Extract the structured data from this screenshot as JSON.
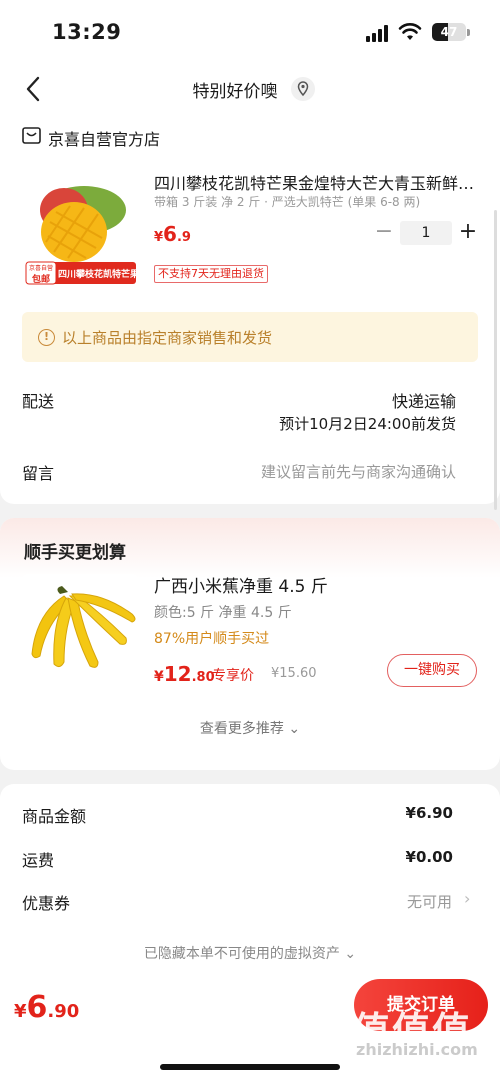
{
  "status": {
    "time": "13:29",
    "battery": "47",
    "battery_level": 0.47
  },
  "nav": {
    "title": "特别好价噢"
  },
  "order": {
    "store_name": "京喜自营官方店",
    "product": {
      "title": "四川攀枝花凯特芒果金煌特大芒大青玉新鲜水果",
      "spec": "带箱 3 斤装 净 2 斤 · 严选大凯特芒 (单果 6-8 两)",
      "price_symbol": "¥",
      "price_int": "6",
      "price_dec": ".9",
      "quantity": "1",
      "minus": "−",
      "plus": "+",
      "return_policy": "不支持7天无理由退货",
      "image_badge_top": "京喜自营",
      "image_badge_free": "包邮",
      "image_badge_label": "四川攀枝花凯特芒果"
    },
    "notice": "以上商品由指定商家销售和发货",
    "notice_icon": "!",
    "delivery_label": "配送",
    "delivery_method": "快递运输",
    "delivery_estimate": "预计10月2日24:00前发货",
    "note_label": "留言",
    "note_placeholder": "建议留言前先与商家沟通确认"
  },
  "upsell": {
    "title": "顺手买更划算",
    "name": "广西小米蕉净重 4.5 斤",
    "spec": "颜色:5 斤 净重 4.5 斤",
    "bought": "87%用户顺手买过",
    "price_symbol": "¥",
    "price_int": "12",
    "price_dec": ".80",
    "price_tag": "专享价",
    "original_price": "¥15.60",
    "buy_label": "一键购买",
    "more_label": "查看更多推荐 ⌄"
  },
  "summary": {
    "goods_label": "商品金额",
    "goods_value": "¥6.90",
    "shipping_label": "运费",
    "shipping_value": "¥0.00",
    "coupon_label": "优惠券",
    "coupon_value": "无可用",
    "coupon_arrow": "›",
    "hidden_assets": "已隐藏本单不可使用的虚拟资产 ⌄"
  },
  "bottom": {
    "price_symbol": "¥",
    "price_int": "6",
    "price_dec": ".90",
    "submit_label": "提交订单"
  },
  "watermark": {
    "main": "值值值",
    "sub": "zhizhizhi.com"
  },
  "colors": {
    "accent": "#e2231a",
    "notice_bg": "#fdf5df",
    "notice_text": "#b9802b"
  }
}
